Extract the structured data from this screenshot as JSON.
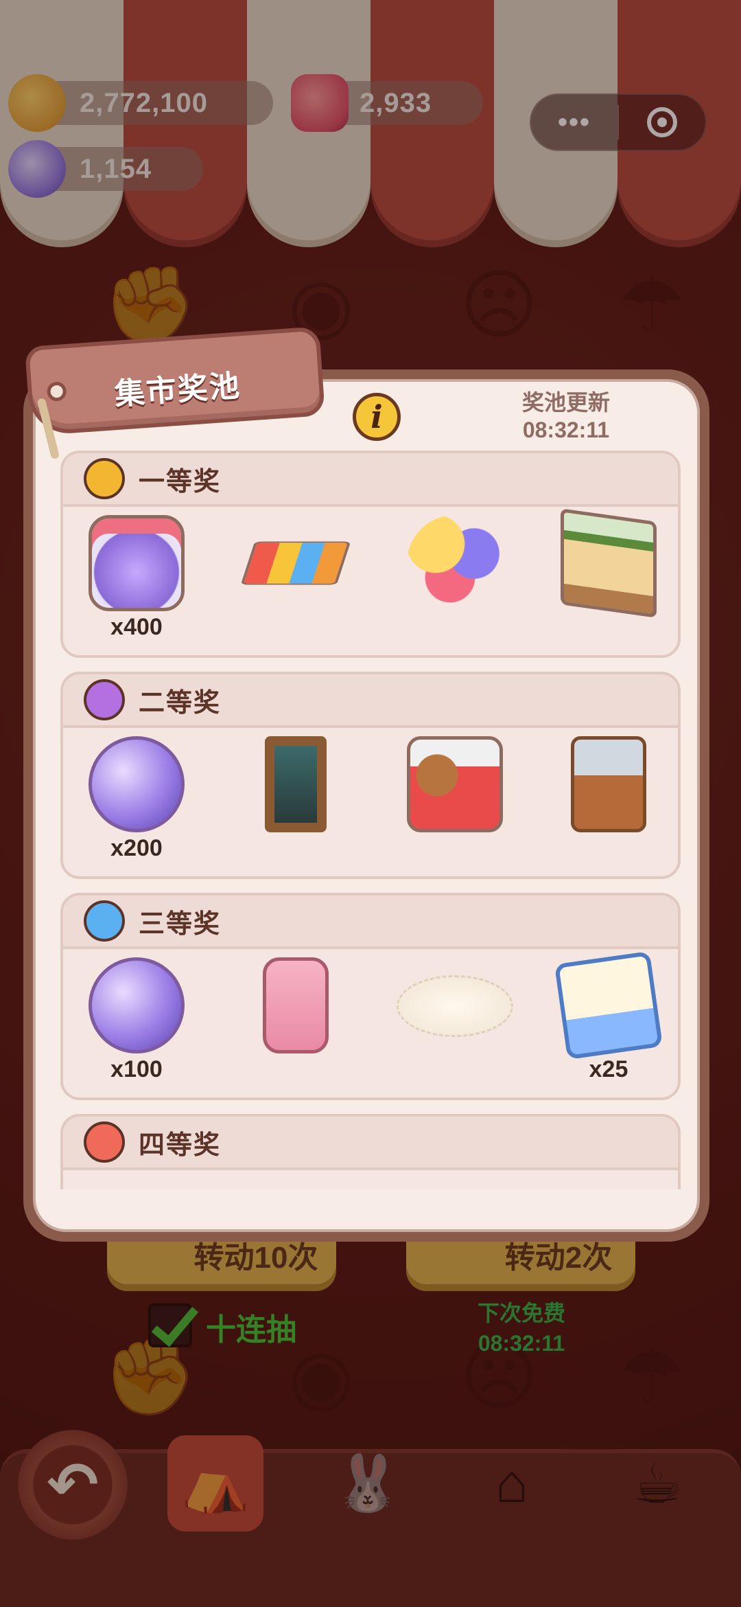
{
  "currencies": {
    "cookies": {
      "value": "2,772,100",
      "icon": "cookie-icon"
    },
    "candy": {
      "value": "2,933",
      "icon": "candy-icon"
    },
    "gems": {
      "value": "1,154",
      "icon": "gem-icon"
    }
  },
  "capsule": {
    "more_icon": "more-dots-icon",
    "close_icon": "target-icon"
  },
  "background_controls": {
    "spin10_label": "转动10次",
    "spin2_label": "转动2次",
    "ten_draw_label": "十连抽",
    "ten_draw_checked": true,
    "next_free_label": "下次免费",
    "next_free_time": "08:32:11"
  },
  "modal": {
    "title": "集市奖池",
    "info_icon": "info-icon",
    "refresh_label": "奖池更新",
    "refresh_time": "08:32:11",
    "tiers": [
      {
        "name": "一等奖",
        "color": "#f2b630",
        "items": [
          {
            "icon": "gem-jar-icon",
            "qty": "x400"
          },
          {
            "icon": "hopscotch-mat-icon",
            "qty": ""
          },
          {
            "icon": "balloons-icon",
            "qty": ""
          },
          {
            "icon": "stage-theater-icon",
            "qty": ""
          }
        ]
      },
      {
        "name": "二等奖",
        "color": "#b46fe0",
        "items": [
          {
            "icon": "gem-pile-icon",
            "qty": "x200"
          },
          {
            "icon": "picture-frame-icon",
            "qty": ""
          },
          {
            "icon": "teddy-gift-box-icon",
            "qty": ""
          },
          {
            "icon": "display-cabinet-icon",
            "qty": ""
          }
        ]
      },
      {
        "name": "三等奖",
        "color": "#5ab0f0",
        "items": [
          {
            "icon": "gem-cluster-icon",
            "qty": "x100"
          },
          {
            "icon": "pink-flip-phone-icon",
            "qty": ""
          },
          {
            "icon": "fluffy-rug-icon",
            "qty": ""
          },
          {
            "icon": "storybook-icon",
            "qty": "x25"
          }
        ]
      },
      {
        "name": "四等奖",
        "color": "#f06a5a",
        "items": []
      }
    ]
  },
  "nav": {
    "back_icon": "back-arrow-icon",
    "items": [
      "market-tent-icon",
      "bunny-shop-icon",
      "mushroom-house-icon",
      "chef-icon"
    ]
  }
}
